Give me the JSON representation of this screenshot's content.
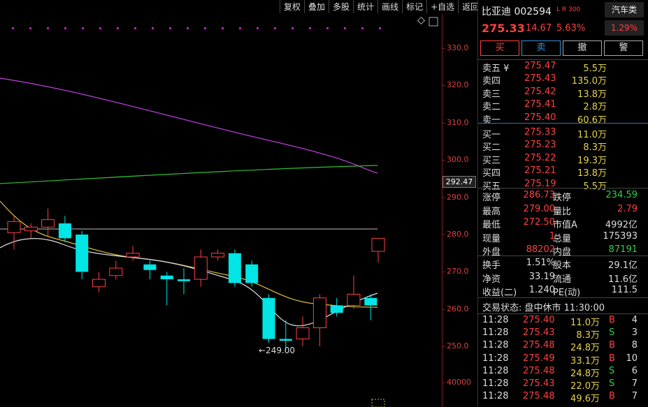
{
  "toolbar": [
    "复权",
    "叠加",
    "多股",
    "统计",
    "画线",
    "标记",
    "+自选",
    "返回"
  ],
  "axis": {
    "ticks": [
      "330.0",
      "320.0",
      "310.0",
      "300.0",
      "290.0",
      "280.0",
      "270.0",
      "260.0",
      "250.0",
      "40000"
    ],
    "current_price_tag": "292.47",
    "low_annotation": "249.00"
  },
  "colors": {
    "up": "#ff4040",
    "down": "#00e5e5",
    "ma_purple": "#c040e0",
    "ma_green": "#30c030",
    "ma_yellow": "#e0c040",
    "ma_white": "#dddddd"
  },
  "stock": {
    "name_code": "比亚迪 002594",
    "tags": "L R 300",
    "price": "275.33",
    "change": "14.67",
    "change_pct": "5.63%",
    "sector_name": "汽车类",
    "sector_pct": "1.29%"
  },
  "buttons": [
    "买",
    "卖",
    "撤",
    "警"
  ],
  "sell": [
    {
      "label": "卖五 ¥",
      "price": "275.47",
      "vol": "5.5万"
    },
    {
      "label": "卖四",
      "price": "275.43",
      "vol": "135.0万"
    },
    {
      "label": "卖三",
      "price": "275.42",
      "vol": "13.8万"
    },
    {
      "label": "卖二",
      "price": "275.41",
      "vol": "2.8万"
    },
    {
      "label": "卖一",
      "price": "275.40",
      "vol": "60.6万"
    }
  ],
  "buy": [
    {
      "label": "买一",
      "price": "275.33",
      "vol": "11.0万"
    },
    {
      "label": "买二",
      "price": "275.23",
      "vol": "8.3万"
    },
    {
      "label": "买三",
      "price": "275.22",
      "vol": "19.3万"
    },
    {
      "label": "买四",
      "price": "275.21",
      "vol": "13.8万"
    },
    {
      "label": "买五",
      "price": "275.19",
      "vol": "5.5万"
    }
  ],
  "stats": [
    {
      "l1": "涨停",
      "v1": "286.73",
      "l2": "跌停",
      "v2": "234.59"
    },
    {
      "l1": "最高",
      "v1": "279.00",
      "l2": "量比",
      "v2": "2.79"
    },
    {
      "l1": "最低",
      "v1": "272.50",
      "l2": "市值A",
      "v2": "4992亿"
    },
    {
      "l1": "现量",
      "v1": "1",
      "l2": "总量",
      "v2": "175393"
    },
    {
      "l1": "外盘",
      "v1": "88202",
      "l2": "内盘",
      "v2": "87191"
    }
  ],
  "stats2": [
    {
      "l1": "换手",
      "v1": "1.51%",
      "l2": "股本",
      "v2": "29.1亿"
    },
    {
      "l1": "净资",
      "v1": "33.19",
      "l2": "流通",
      "v2": "11.6亿"
    },
    {
      "l1": "收益(二)",
      "v1": "1.240",
      "l2": "PE(动)",
      "v2": "111.5"
    }
  ],
  "trade_status": "交易状态: 盘中休市 11:30:00",
  "ticks": [
    {
      "time": "11:28",
      "price": "275.40",
      "vol": "11.0万",
      "side": "B",
      "n": "4"
    },
    {
      "time": "11:28",
      "price": "275.43",
      "vol": "8.3万",
      "side": "S",
      "n": "3"
    },
    {
      "time": "11:28",
      "price": "275.48",
      "vol": "24.8万",
      "side": "B",
      "n": "8"
    },
    {
      "time": "11:28",
      "price": "275.49",
      "vol": "33.1万",
      "side": "B",
      "n": "10"
    },
    {
      "time": "11:28",
      "price": "275.48",
      "vol": "24.8万",
      "side": "S",
      "n": "6"
    },
    {
      "time": "11:28",
      "price": "275.43",
      "vol": "22.0万",
      "side": "S",
      "n": "7"
    },
    {
      "time": "11:28",
      "price": "275.48",
      "vol": "49.6万",
      "side": "B",
      "n": "7"
    }
  ],
  "chart_data": {
    "type": "candlestick",
    "candles": [
      {
        "o": 280.5,
        "c": 283.5,
        "h": 285,
        "l": 276
      },
      {
        "o": 281,
        "c": 282,
        "h": 283,
        "l": 279
      },
      {
        "o": 282,
        "c": 284,
        "h": 287,
        "l": 279.5
      },
      {
        "o": 283,
        "c": 279,
        "h": 285,
        "l": 278
      },
      {
        "o": 280,
        "c": 270,
        "h": 281,
        "l": 268
      },
      {
        "o": 266,
        "c": 268,
        "h": 270,
        "l": 264.5
      },
      {
        "o": 269,
        "c": 271,
        "h": 273,
        "l": 268
      },
      {
        "o": 274,
        "c": 275,
        "h": 277,
        "l": 273
      },
      {
        "o": 272,
        "c": 270.5,
        "h": 273,
        "l": 268
      },
      {
        "o": 269,
        "c": 268,
        "h": 270,
        "l": 261
      },
      {
        "o": 268,
        "c": 267.5,
        "h": 271,
        "l": 264
      },
      {
        "o": 268,
        "c": 274,
        "h": 276,
        "l": 266
      },
      {
        "o": 274,
        "c": 275,
        "h": 276,
        "l": 273
      },
      {
        "o": 275,
        "c": 267,
        "h": 276,
        "l": 266
      },
      {
        "o": 272,
        "c": 267,
        "h": 273,
        "l": 266
      },
      {
        "o": 263,
        "c": 252,
        "h": 264,
        "l": 251
      },
      {
        "o": 252,
        "c": 251.5,
        "h": 257,
        "l": 249
      },
      {
        "o": 252,
        "c": 255,
        "h": 258,
        "l": 250
      },
      {
        "o": 255,
        "c": 263,
        "h": 264,
        "l": 250
      },
      {
        "o": 261,
        "c": 259,
        "h": 263,
        "l": 258
      },
      {
        "o": 261,
        "c": 264,
        "h": 269,
        "l": 260
      },
      {
        "o": 263,
        "c": 261,
        "h": 264,
        "l": 257
      },
      {
        "o": 275.5,
        "c": 279,
        "h": 279,
        "l": 272.5
      }
    ],
    "ylim": [
      244,
      335
    ],
    "reference_line": 281
  }
}
